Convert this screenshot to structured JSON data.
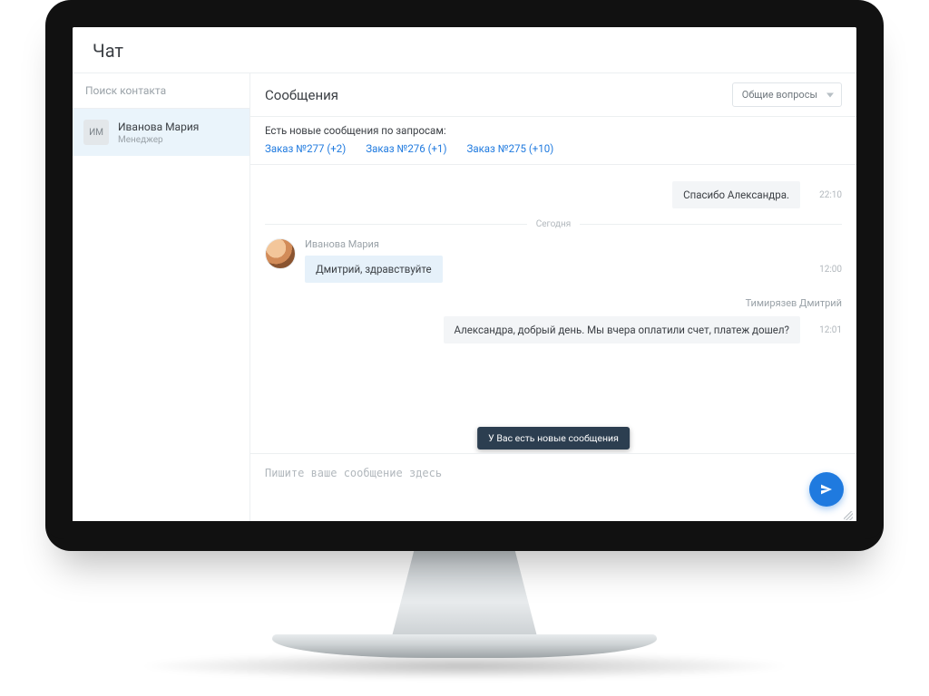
{
  "app": {
    "title": "Чат"
  },
  "sidebar": {
    "search_placeholder": "Поиск контакта",
    "contact": {
      "initials": "ИМ",
      "name": "Иванова Мария",
      "role": "Менеджер"
    }
  },
  "main": {
    "title": "Сообщения",
    "filter_label": "Общие вопросы"
  },
  "notice": {
    "heading": "Есть новые сообщения по запросам:",
    "links": {
      "a": "Заказ №277 (+2)",
      "b": "Заказ №276 (+1)",
      "c": "Заказ №275 (+10)"
    }
  },
  "thread": {
    "prev_bubble": "Спасибо Александра.",
    "prev_time": "22:10",
    "day_label": "Сегодня",
    "m1_sender": "Иванова Мария",
    "m1_text": "Дмитрий, здравствуйте",
    "m1_time": "12:00",
    "m2_sender": "Тимирязев Дмитрий",
    "m2_text": "Александра, добрый день. Мы вчера оплатили счет, платеж дошел?",
    "m2_time": "12:01",
    "tooltip": "У Вас есть новые сообщения"
  },
  "composer": {
    "placeholder": "Пишите ваше сообщение здесь"
  }
}
